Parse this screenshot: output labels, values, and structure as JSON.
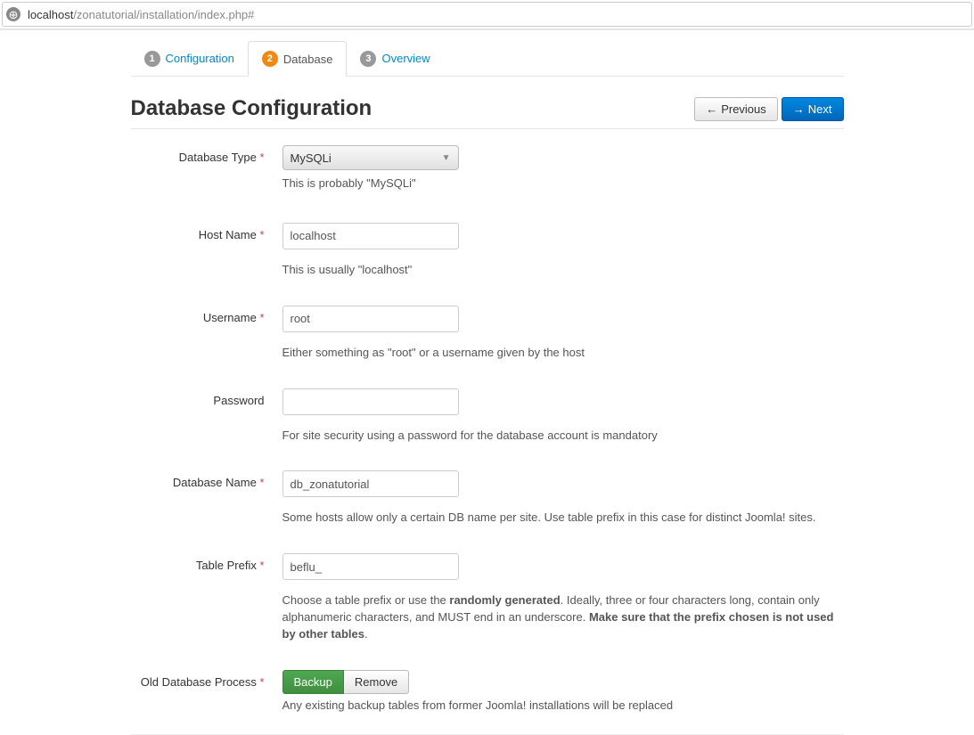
{
  "url": {
    "host": "localhost",
    "path": "/zonatutorial/installation/index.php#"
  },
  "steps": [
    {
      "num": "1",
      "label": "Configuration"
    },
    {
      "num": "2",
      "label": "Database"
    },
    {
      "num": "3",
      "label": "Overview"
    }
  ],
  "title": "Database Configuration",
  "buttons": {
    "previous": "Previous",
    "next": "Next"
  },
  "form": {
    "db_type": {
      "label": "Database Type",
      "value": "MySQLi",
      "help": "This is probably \"MySQLi\""
    },
    "host": {
      "label": "Host Name",
      "value": "localhost",
      "help": "This is usually \"localhost\""
    },
    "username": {
      "label": "Username",
      "value": "root",
      "help": "Either something as \"root\" or a username given by the host"
    },
    "password": {
      "label": "Password",
      "value": "",
      "help": "For site security using a password for the database account is mandatory"
    },
    "db_name": {
      "label": "Database Name",
      "value": "db_zonatutorial",
      "help": "Some hosts allow only a certain DB name per site. Use table prefix in this case for distinct Joomla! sites."
    },
    "prefix": {
      "label": "Table Prefix",
      "value": "beflu_",
      "help_pre": "Choose a table prefix or use the ",
      "help_b1": "randomly generated",
      "help_mid": ". Ideally, three or four characters long, contain only alphanumeric characters, and MUST end in an underscore. ",
      "help_b2": "Make sure that the prefix chosen is not used by other tables",
      "help_suf": "."
    },
    "old_db": {
      "label": "Old Database Process",
      "backup": "Backup",
      "remove": "Remove",
      "help": "Any existing backup tables from former Joomla! installations will be replaced"
    }
  },
  "required_star": " *"
}
